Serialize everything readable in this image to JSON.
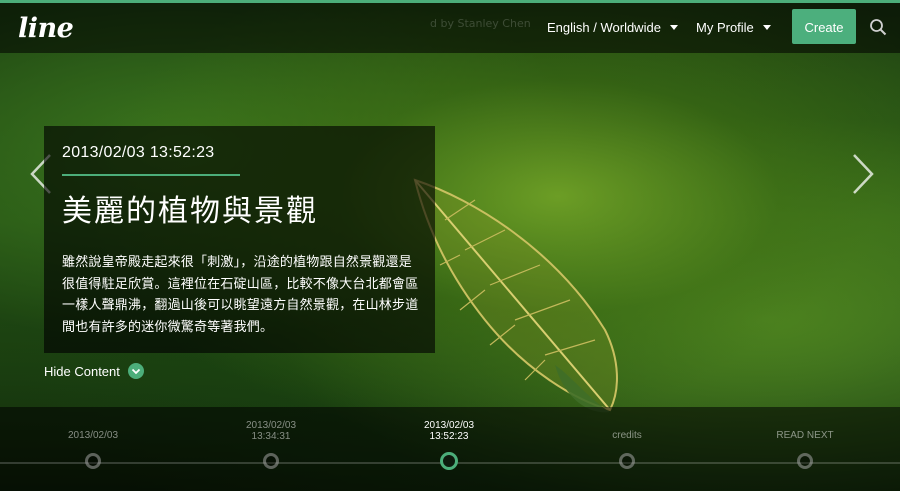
{
  "header": {
    "logo": "line",
    "credit": "d by Stanley Chen",
    "language": "English / Worldwide",
    "profile": "My Profile",
    "create_label": "Create"
  },
  "post": {
    "date": "2013/02/03 13:52:23",
    "title": "美麗的植物與景觀",
    "body": "雖然說皇帝殿走起來很「刺激」，沿途的植物跟自然景觀還是很值得駐足欣賞。這裡位在石碇山區，比較不像大台北都會區一樣人聲鼎沸，翻過山後可以眺望遠方自然景觀，在山林步道間也有許多的迷你微驚奇等著我們。",
    "hide_label": "Hide Content"
  },
  "timeline": {
    "items": [
      {
        "line1": "2013/02/03",
        "line2": "",
        "active": false
      },
      {
        "line1": "2013/02/03",
        "line2": "13:34:31",
        "active": false
      },
      {
        "line1": "2013/02/03",
        "line2": "13:52:23",
        "active": true
      },
      {
        "line1": "credits",
        "line2": "",
        "active": false
      },
      {
        "line1": "READ NEXT",
        "line2": "",
        "active": false
      }
    ]
  },
  "colors": {
    "accent": "#4cae7a"
  },
  "icons": {
    "prev": "chevron-left-icon",
    "next": "chevron-right-icon",
    "search": "search-icon",
    "hide": "chevron-down-icon"
  }
}
